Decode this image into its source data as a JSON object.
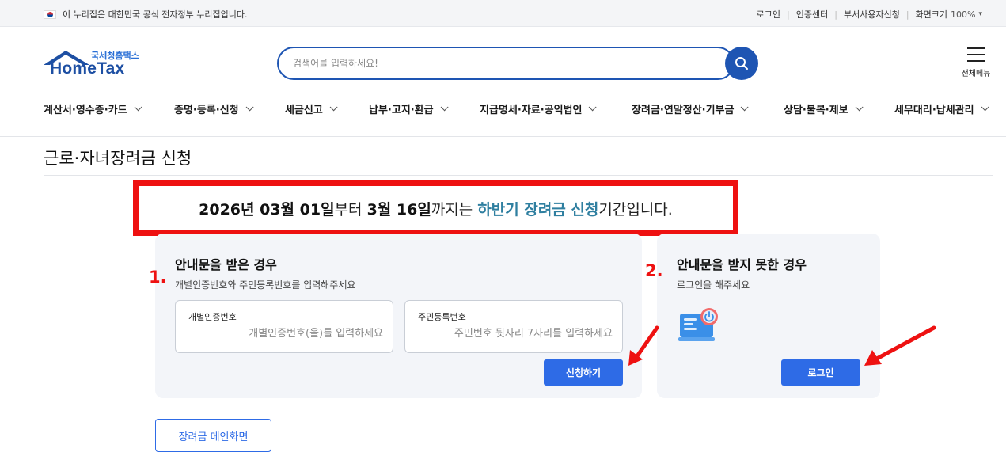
{
  "gov_banner": {
    "text": "이 누리집은 대한민국 공식 전자정부 누리집입니다.",
    "links": [
      "로그인",
      "인증센터",
      "부서사용자신청"
    ],
    "zoom_label": "화면크기",
    "zoom_value": "100%"
  },
  "header": {
    "logo_sub": "국세청홈택스",
    "logo_main": "HomeTax",
    "search_placeholder": "검색어를 입력하세요!",
    "all_menu_label": "전체메뉴"
  },
  "nav": {
    "items": [
      "계산서·영수증·카드",
      "증명·등록·신청",
      "세금신고",
      "납부·고지·환급",
      "지급명세·자료·공익법인",
      "장려금·연말정산·기부금",
      "상담·불복·제보",
      "세무대리·납세관리"
    ]
  },
  "page": {
    "title": "근로·자녀장려금 신청"
  },
  "notice": {
    "part1": "2026년 03월 01일",
    "part2": "부터 ",
    "part3": "3월 16일",
    "part4": "까지는 ",
    "part5": "하반기 장려금 신청",
    "part6": "기간입니다."
  },
  "card_notice": {
    "step": "1.",
    "title": "안내문을 받은 경우",
    "desc": "개별인증번호와 주민등록번호를 입력해주세요",
    "field1_label": "개별인증번호",
    "field1_placeholder": "개별인증번호(을)를 입력하세요",
    "field2_label": "주민등록번호",
    "field2_placeholder": "주민번호 뒷자리 7자리를 입력하세요",
    "submit_label": "신청하기"
  },
  "card_login": {
    "step": "2.",
    "title": "안내문을 받지 못한 경우",
    "desc": "로그인을 해주세요",
    "login_label": "로그인"
  },
  "main_button_label": "장려금 메인화면",
  "colors": {
    "brand_blue": "#1e55b3",
    "button_blue": "#2e6be6",
    "highlight_teal": "#2f7fa0",
    "annotation_red": "#ee1111"
  },
  "icons": [
    "korea-flag-icon",
    "search-icon",
    "hamburger-menu-icon",
    "chevron-down-icon",
    "laptop-login-icon",
    "red-arrow-annotation"
  ]
}
